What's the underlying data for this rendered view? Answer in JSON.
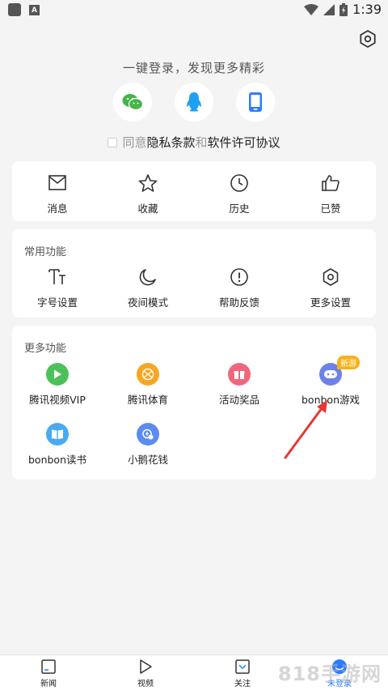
{
  "status": {
    "time": "1:39"
  },
  "login": {
    "prompt": "一键登录，发现更多精彩"
  },
  "agreement": {
    "prefix": "同意",
    "privacy": "隐私条款",
    "and": "和",
    "license": "软件许可协议"
  },
  "quick": [
    {
      "label": "消息",
      "icon": "message-icon"
    },
    {
      "label": "收藏",
      "icon": "star-icon"
    },
    {
      "label": "历史",
      "icon": "clock-icon"
    },
    {
      "label": "已赞",
      "icon": "thumbs-up-icon"
    }
  ],
  "common": {
    "title": "常用功能",
    "items": [
      {
        "label": "字号设置",
        "icon": "font-size-icon"
      },
      {
        "label": "夜间模式",
        "icon": "moon-icon"
      },
      {
        "label": "帮助反馈",
        "icon": "help-icon"
      },
      {
        "label": "更多设置",
        "icon": "hex-settings-icon"
      }
    ]
  },
  "more": {
    "title": "更多功能",
    "items": [
      {
        "label": "腾讯视频VIP",
        "icon": "video-vip-icon",
        "color": "#4cc15b"
      },
      {
        "label": "腾讯体育",
        "icon": "sports-ball-icon",
        "color": "#f5a623"
      },
      {
        "label": "活动奖品",
        "icon": "gift-icon",
        "color": "#f2667d"
      },
      {
        "label": "bonbon游戏",
        "icon": "gamepad-icon",
        "color": "#6c82e8",
        "badge": "新游"
      },
      {
        "label": "bonbon读书",
        "icon": "book-icon",
        "color": "#4aaaf0"
      },
      {
        "label": "小鹅花钱",
        "icon": "wallet-icon",
        "color": "#5b8bf0"
      }
    ]
  },
  "nav": [
    {
      "label": "新闻",
      "icon": "news-icon"
    },
    {
      "label": "视频",
      "icon": "video-play-icon"
    },
    {
      "label": "关注",
      "icon": "follow-icon"
    },
    {
      "label": "未登录",
      "icon": "avatar-icon"
    }
  ],
  "watermark": "818手游网",
  "colors": {
    "accent": "#2a7cff",
    "arrow": "#e53935",
    "card": "#ffffff",
    "background": "#f4f4f4"
  }
}
